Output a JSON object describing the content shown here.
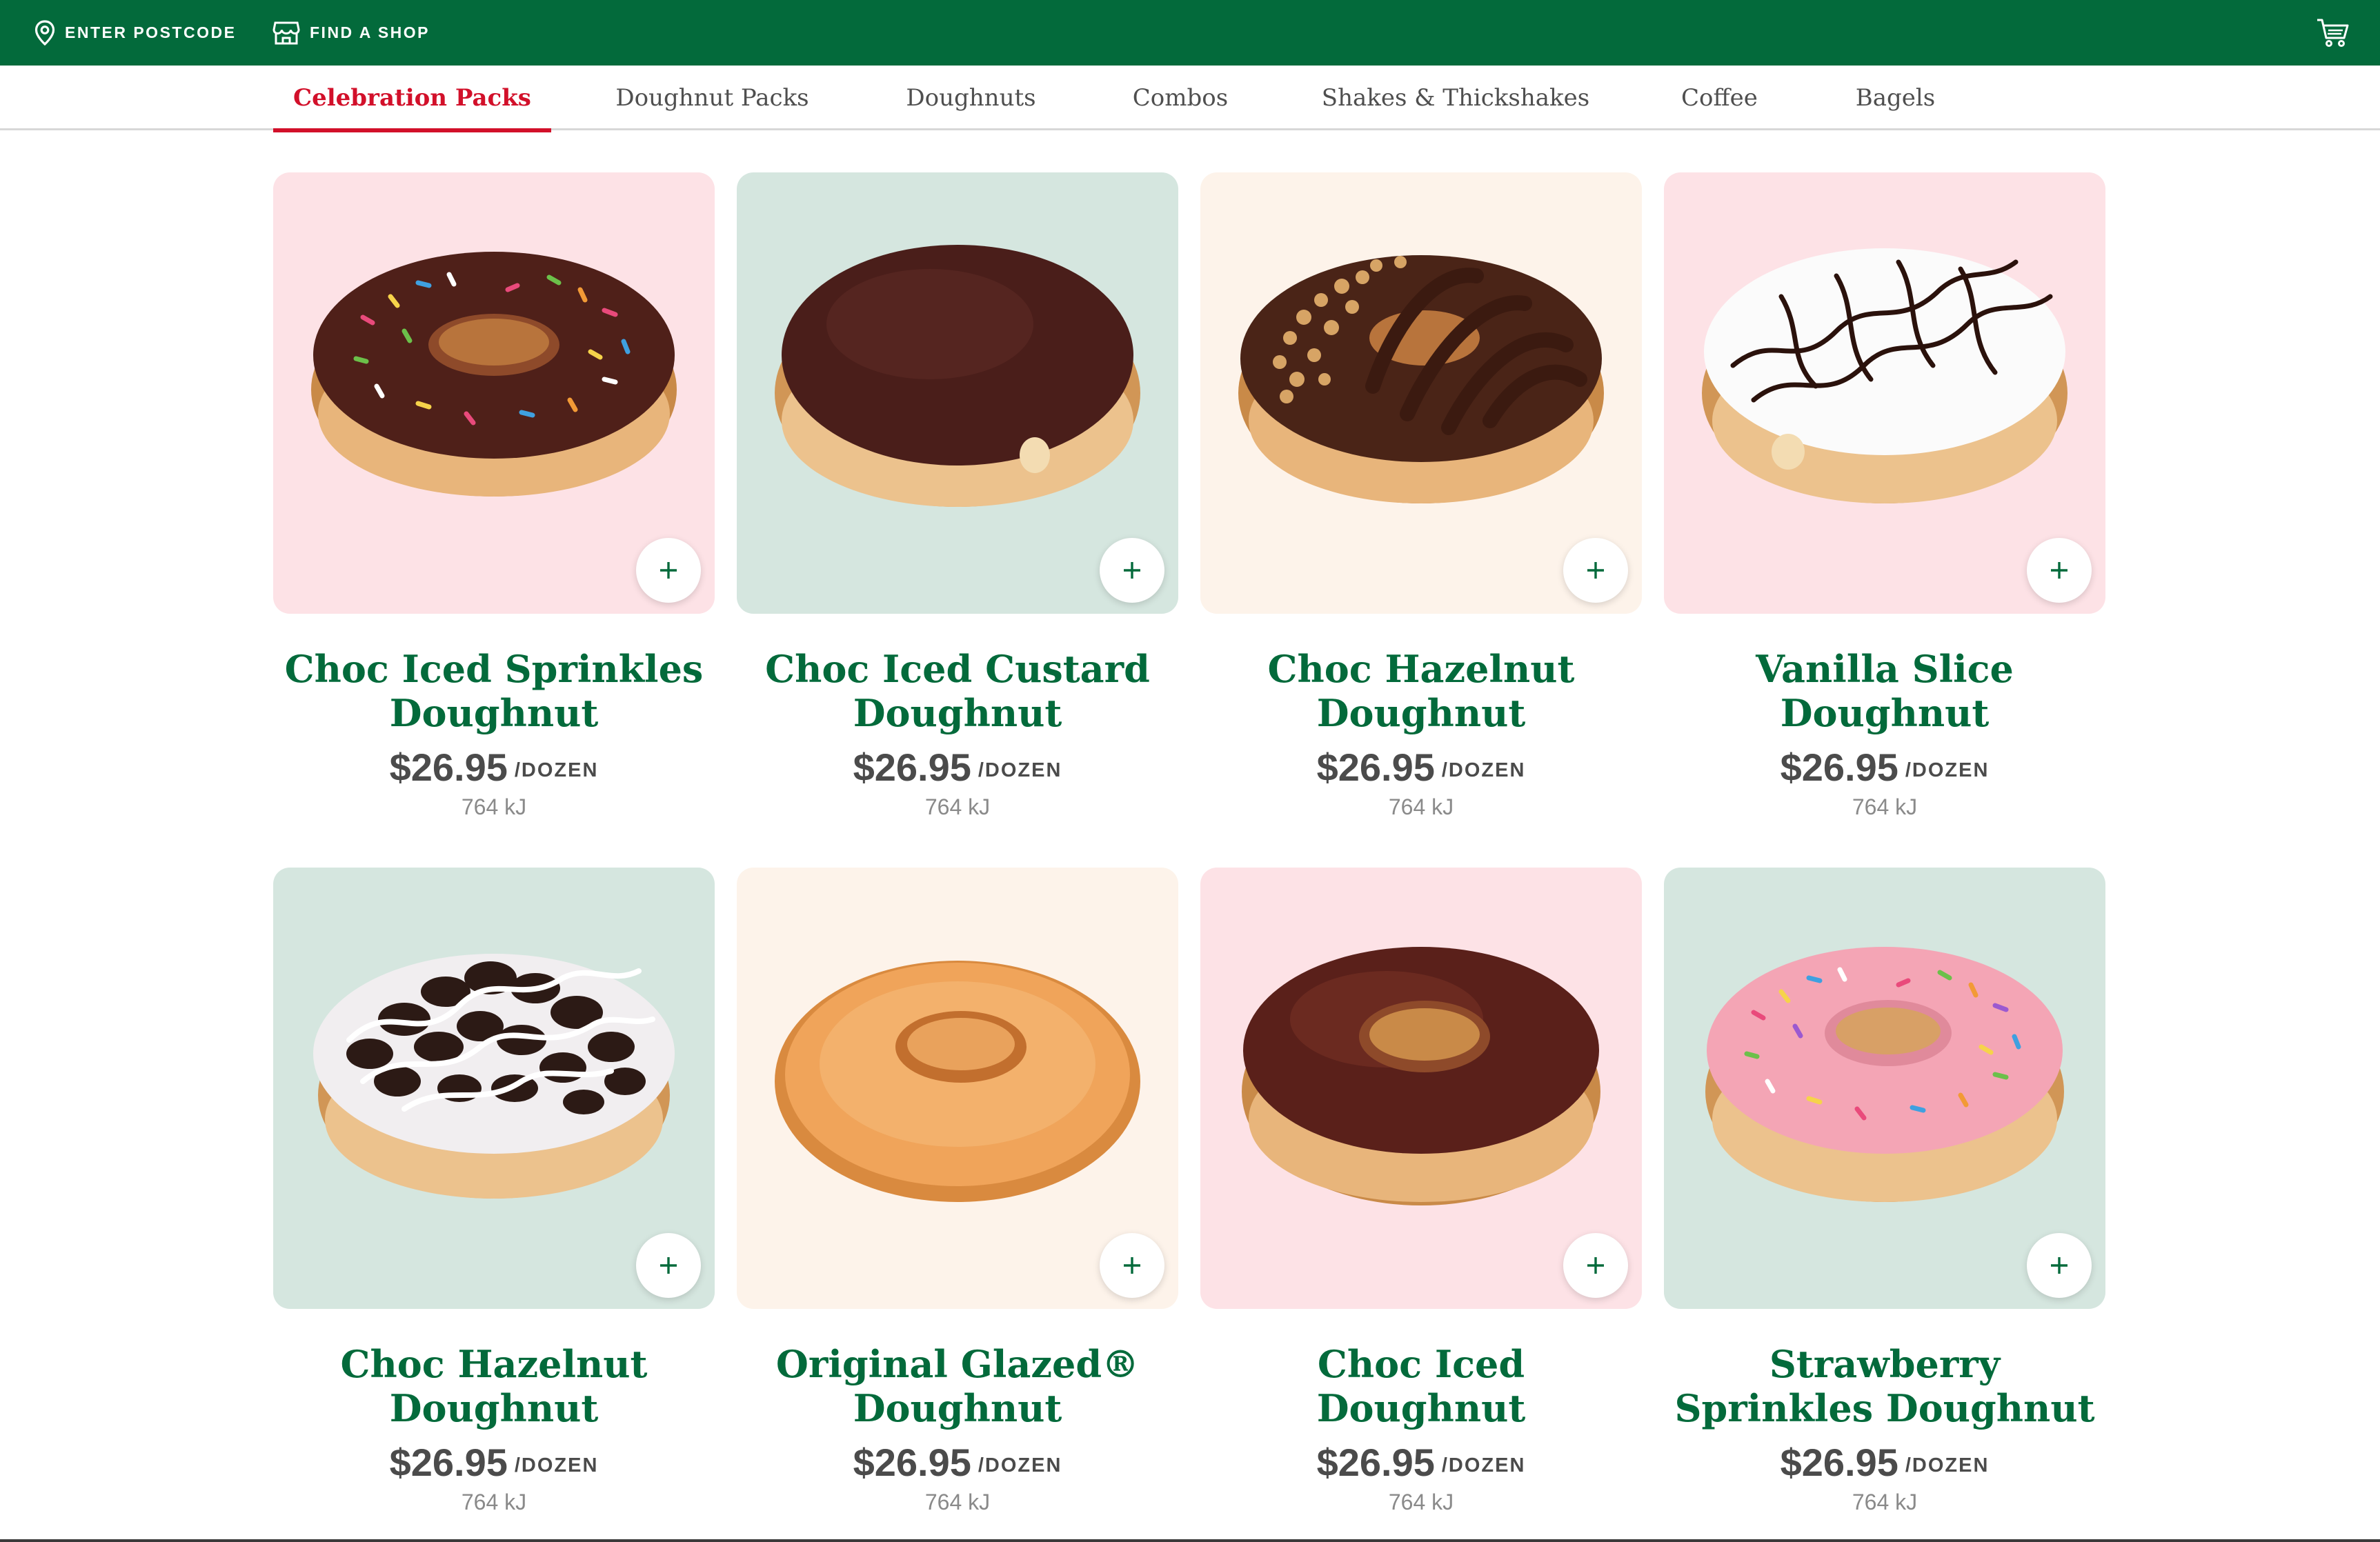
{
  "topbar": {
    "postcode_label": "ENTER POSTCODE",
    "shop_label": "FIND A SHOP",
    "icons": [
      "location-pin-icon",
      "shop-icon",
      "cart-icon"
    ]
  },
  "categories": [
    {
      "label": "Celebration Packs",
      "active": true
    },
    {
      "label": "Doughnut Packs"
    },
    {
      "label": "Doughnuts"
    },
    {
      "label": "Combos"
    },
    {
      "label": "Shakes & Thickshakes"
    },
    {
      "label": "Coffee"
    },
    {
      "label": "Bagels"
    }
  ],
  "products": [
    {
      "name": "Choc Iced Sprinkles Doughnut",
      "price": "$26.95",
      "unit": "/DOZEN",
      "energy": "764 kJ",
      "tile": "pink",
      "icon": "choc-sprinkles-doughnut-image"
    },
    {
      "name": "Choc Iced Custard Doughnut",
      "price": "$26.95",
      "unit": "/DOZEN",
      "energy": "764 kJ",
      "tile": "mint",
      "icon": "choc-custard-doughnut-image"
    },
    {
      "name": "Choc Hazelnut Doughnut",
      "price": "$26.95",
      "unit": "/DOZEN",
      "energy": "764 kJ",
      "tile": "cream",
      "icon": "choc-hazelnut-doughnut-image"
    },
    {
      "name": "Vanilla Slice Doughnut",
      "price": "$26.95",
      "unit": "/DOZEN",
      "energy": "764 kJ",
      "tile": "pink",
      "icon": "vanilla-slice-doughnut-image"
    },
    {
      "name": "Choc Hazelnut Doughnut",
      "price": "$26.95",
      "unit": "/DOZEN",
      "energy": "764 kJ",
      "tile": "mint",
      "icon": "cookies-and-cream-doughnut-image"
    },
    {
      "name": "Original Glazed® Doughnut",
      "price": "$26.95",
      "unit": "/DOZEN",
      "energy": "764 kJ",
      "tile": "cream",
      "icon": "original-glazed-doughnut-image"
    },
    {
      "name": "Choc Iced Doughnut",
      "price": "$26.95",
      "unit": "/DOZEN",
      "energy": "764 kJ",
      "tile": "pink",
      "icon": "choc-iced-doughnut-image"
    },
    {
      "name": "Strawberry Sprinkles Doughnut",
      "price": "$26.95",
      "unit": "/DOZEN",
      "energy": "764 kJ",
      "tile": "mint",
      "icon": "strawberry-sprinkles-doughnut-image"
    }
  ],
  "colors": {
    "brand_green": "#036a3b",
    "active_red": "#d2102a",
    "tile_pink": "#fde2e6",
    "tile_mint": "#d5e6df",
    "tile_cream": "#fdf3ea"
  }
}
